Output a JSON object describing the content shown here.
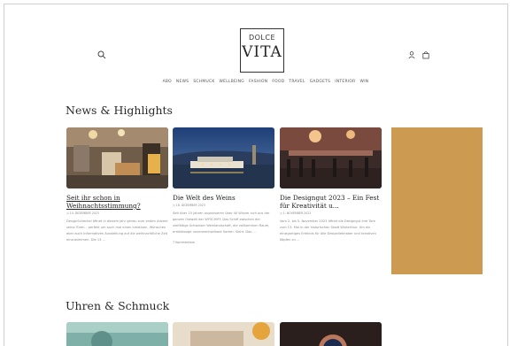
{
  "logo": {
    "line1": "DOLCE",
    "line2": "VITA"
  },
  "header": {
    "search_icon": "search-icon",
    "account_icon": "user-icon",
    "cart_icon": "bag-icon"
  },
  "nav": [
    "ABO",
    "NEWS",
    "SCHMUCK",
    "WELLBEING",
    "FASHION",
    "FOOD",
    "TRAVEL",
    "GADGETS",
    "INTERIOR",
    "WIN"
  ],
  "news": {
    "title": "News & Highlights",
    "cards": [
      {
        "title": "Seit ihr schon in Weihnachtsstimmung?",
        "date": "15. DEZEMBER 2023",
        "excerpt": "DesignSchenkel öffnet in diesem Jahr genau zum ersten Advent seine Türen – perfekt um auch mal einen kreativen, Wünschen aber auch informativen Ausstellung auf die weihnachtliche Zeit einzustimmen. Die 13 ...",
        "comments": ""
      },
      {
        "title": "Die Welt des Weins",
        "date": "18. DEZEMBER 2023",
        "excerpt": "Seit über 15 Jahren organisieren über 40 Winzer sich aus der ganzen Ostwelt der WYSCHIFF. Das Schiff zwischen die vielfältige Schweizer Weinlandschaft, die vollkommen Raum, erstklassige unverwechselbare Sorten. Sieht. Das ...",
        "comments": "7 Kommentare"
      },
      {
        "title": "Die Designgut 2023 – Ein Fest für Kreativität u...",
        "date": "1. NOVEMBER 2023",
        "excerpt": "Vom 2. bis 5. November 2023 öffnet die Designgut ihre Tore zum 13. Mal in der historischen Stadt Winterthur. Um ein einzigartiges Erlebnis für alle Designliebhaber und kreativen Köpfen zu ...",
        "comments": ""
      }
    ]
  },
  "uhren": {
    "title": "Uhren & Schmuck"
  },
  "colors": {
    "ad": "#cd9a51",
    "text": "#222222",
    "muted": "#888888",
    "border": "#cfcfcf"
  }
}
